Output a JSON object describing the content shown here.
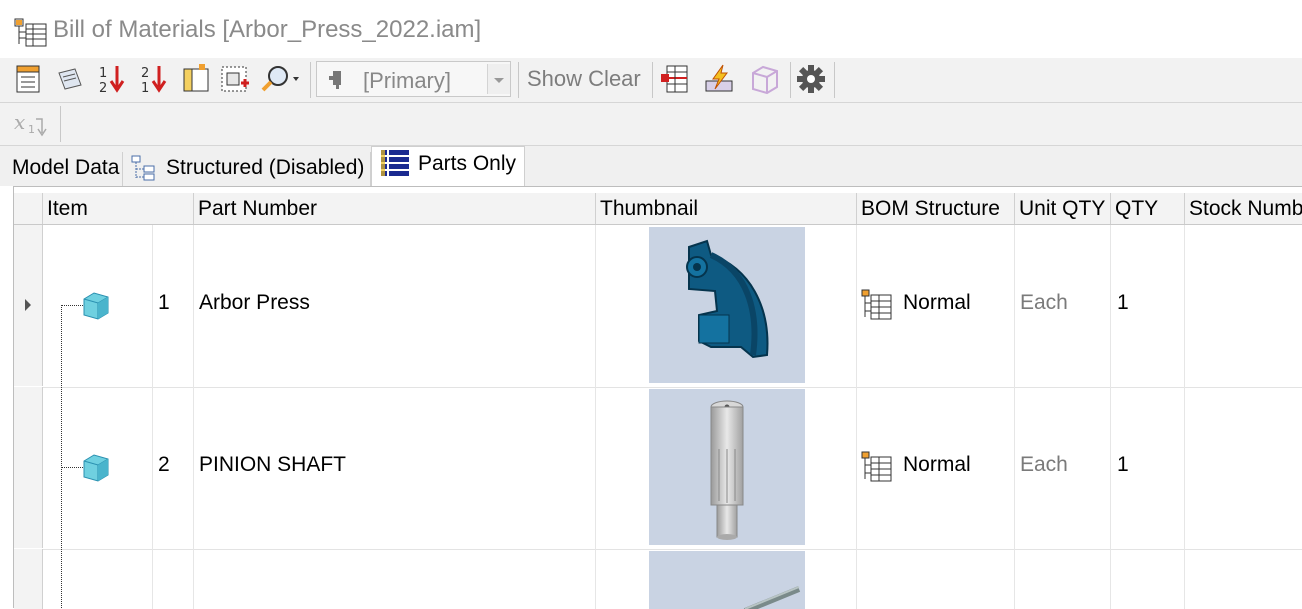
{
  "window": {
    "title": "Bill of Materials [Arbor_Press_2022.iam]"
  },
  "toolbar": {
    "view_select": {
      "value": "[Primary]"
    },
    "show_label": "Show",
    "clear_label": "Clear",
    "icons": [
      "bom-export-icon",
      "bom-edit-icon",
      "sort-ascending-icon",
      "sort-descending-icon",
      "add-custom-column-icon",
      "choose-columns-icon",
      "find-icon",
      "view-select-icon",
      "part-number-merge-icon",
      "update-mass-icon",
      "add-virtual-component-icon",
      "settings-gear-icon"
    ]
  },
  "formula_bar": {
    "icon": "formula-fx-icon"
  },
  "tabs": [
    {
      "label": "Model Data",
      "active": false
    },
    {
      "label": "Structured (Disabled)",
      "active": false
    },
    {
      "label": "Parts Only",
      "active": true
    }
  ],
  "grid": {
    "columns": [
      "Item",
      "Part Number",
      "Thumbnail",
      "BOM Structure",
      "Unit QTY",
      "QTY",
      "Stock Numb"
    ],
    "rows": [
      {
        "item": "1",
        "part_number": "Arbor Press",
        "thumbnail": "arbor-press-frame",
        "bom_structure": "Normal",
        "unit_qty": "Each",
        "qty": "1"
      },
      {
        "item": "2",
        "part_number": "PINION SHAFT",
        "thumbnail": "pinion-shaft",
        "bom_structure": "Normal",
        "unit_qty": "Each",
        "qty": "1"
      },
      {
        "item": "",
        "part_number": "",
        "thumbnail": "rod",
        "bom_structure": "",
        "unit_qty": "",
        "qty": ""
      }
    ]
  },
  "colors": {
    "toolbar_bg": "#f2f2f2",
    "thumb_bg": "#c9d3e3",
    "part_blue": "#0e5a82",
    "cube": "#6fd0e0"
  }
}
